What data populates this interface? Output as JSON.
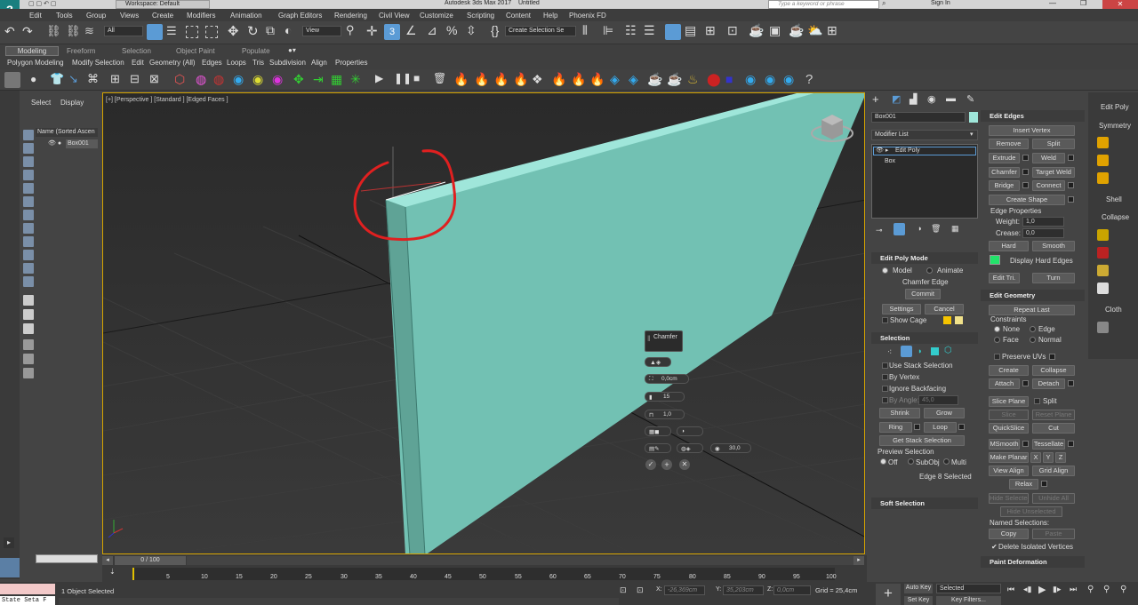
{
  "title_bar": {
    "workspace": "Workspace: Default",
    "app_title": "Autodesk 3ds Max 2017",
    "file_name": "Untitled",
    "search_placeholder": "Type a keyword or phrase",
    "sign_in": "Sign In"
  },
  "menu": [
    "Edit",
    "Tools",
    "Group",
    "Views",
    "Create",
    "Modifiers",
    "Animation",
    "Graph Editors",
    "Rendering",
    "Civil View",
    "Customize",
    "Scripting",
    "Content",
    "Help",
    "Phoenix FD"
  ],
  "toolbar": {
    "filter": "All",
    "ref_coord": "View",
    "selection_set": "Create Selection Se"
  },
  "ribbon_tabs": [
    "Modeling",
    "Freeform",
    "Selection",
    "Object Paint",
    "Populate"
  ],
  "ribbon_panels": [
    "Polygon Modeling",
    "Modify Selection",
    "Edit",
    "Geometry (All)",
    "Edges",
    "Loops",
    "Tris",
    "Subdivision",
    "Align",
    "Properties"
  ],
  "scene_explorer": {
    "tab_select": "Select",
    "tab_display": "Display",
    "header": "Name (Sorted Ascen",
    "item": "Box001"
  },
  "viewport": {
    "label": "[+] [Perspective ] [Standard ] [Edged Faces ]"
  },
  "caddy": {
    "title": "Chamfer",
    "amount": "0,0cm",
    "segments": "15",
    "tension": "1,0",
    "angle": "30,0"
  },
  "command_panel": {
    "object_name": "Box001",
    "modifier_list": "Modifier List",
    "stack": [
      "Edit Poly",
      "Box"
    ],
    "edit_poly_mode": {
      "title": "Edit Poly Mode",
      "model": "Model",
      "animate": "Animate",
      "op": "Chamfer Edge",
      "commit": "Commit",
      "settings": "Settings",
      "cancel": "Cancel",
      "show_cage": "Show Cage"
    },
    "selection": {
      "title": "Selection",
      "use_stack": "Use Stack Selection",
      "by_vertex": "By Vertex",
      "ignore_backfacing": "Ignore Backfacing",
      "by_angle": "By Angle:",
      "angle_val": "45,0",
      "shrink": "Shrink",
      "grow": "Grow",
      "ring": "Ring",
      "loop": "Loop",
      "get_stack": "Get Stack Selection",
      "preview": "Preview Selection",
      "off": "Off",
      "subobj": "SubObj",
      "multi": "Multi",
      "status": "Edge 8 Selected"
    },
    "soft_selection": "Soft Selection",
    "edit_edges": {
      "title": "Edit Edges",
      "insert_vertex": "Insert Vertex",
      "remove": "Remove",
      "split": "Split",
      "extrude": "Extrude",
      "weld": "Weld",
      "chamfer": "Chamfer",
      "target_weld": "Target Weld",
      "bridge": "Bridge",
      "connect": "Connect",
      "create_shape": "Create Shape",
      "edge_props": "Edge Properties",
      "weight": "Weight:",
      "weight_val": "1,0",
      "crease": "Crease:",
      "crease_val": "0,0",
      "hard": "Hard",
      "smooth": "Smooth",
      "display_hard": "Display Hard Edges",
      "edit_tri": "Edit Tri.",
      "turn": "Turn"
    },
    "edit_geometry": {
      "title": "Edit Geometry",
      "repeat_last": "Repeat Last",
      "constraints": "Constraints",
      "none": "None",
      "edge": "Edge",
      "face": "Face",
      "normal": "Normal",
      "preserve_uvs": "Preserve UVs",
      "create": "Create",
      "collapse": "Collapse",
      "attach": "Attach",
      "detach": "Detach",
      "slice_plane": "Slice Plane",
      "split": "Split",
      "slice": "Slice",
      "reset_plane": "Reset Plane",
      "quickslice": "QuickSlice",
      "cut": "Cut",
      "msmooth": "MSmooth",
      "tessellate": "Tessellate",
      "make_planar": "Make Planar",
      "x": "X",
      "y": "Y",
      "z": "Z",
      "view_align": "View Align",
      "grid_align": "Grid Align",
      "relax": "Relax",
      "hide_selected": "Hide Selected",
      "unhide_all": "Unhide All",
      "hide_unselected": "Hide Unselected",
      "named_selections": "Named Selections:",
      "copy": "Copy",
      "paste": "Paste",
      "delete_isolated": "Delete Isolated Vertices"
    },
    "paint_deformation": "Paint Deformation"
  },
  "modifier_shortcuts": [
    "Edit Poly",
    "Symmetry",
    "Shell",
    "Collapse",
    "Cloth"
  ],
  "timeline": {
    "slider": "0 / 100",
    "ticks": [
      "5",
      "10",
      "15",
      "20",
      "25",
      "30",
      "35",
      "40",
      "45",
      "50",
      "55",
      "60",
      "65",
      "70",
      "75",
      "80",
      "85",
      "90",
      "95",
      "100"
    ]
  },
  "status": {
    "maxscript": "State Seta F",
    "objects": "1 Object Selected",
    "x_label": "X:",
    "x": "-26,369cm",
    "y_label": "Y:",
    "y": "35,203cm",
    "z_label": "Z:",
    "z": "0,0cm",
    "grid": "Grid = 25,4cm",
    "auto_key": "Auto Key",
    "set_key": "Set Key",
    "selected": "Selected",
    "key_filters": "Key Filters..."
  },
  "colors": {
    "object": "#72c1b3",
    "object_top": "#9fe6da",
    "annotation": "#e02020",
    "accent": "#5b9bd5",
    "viewport_bg": "#323232"
  }
}
